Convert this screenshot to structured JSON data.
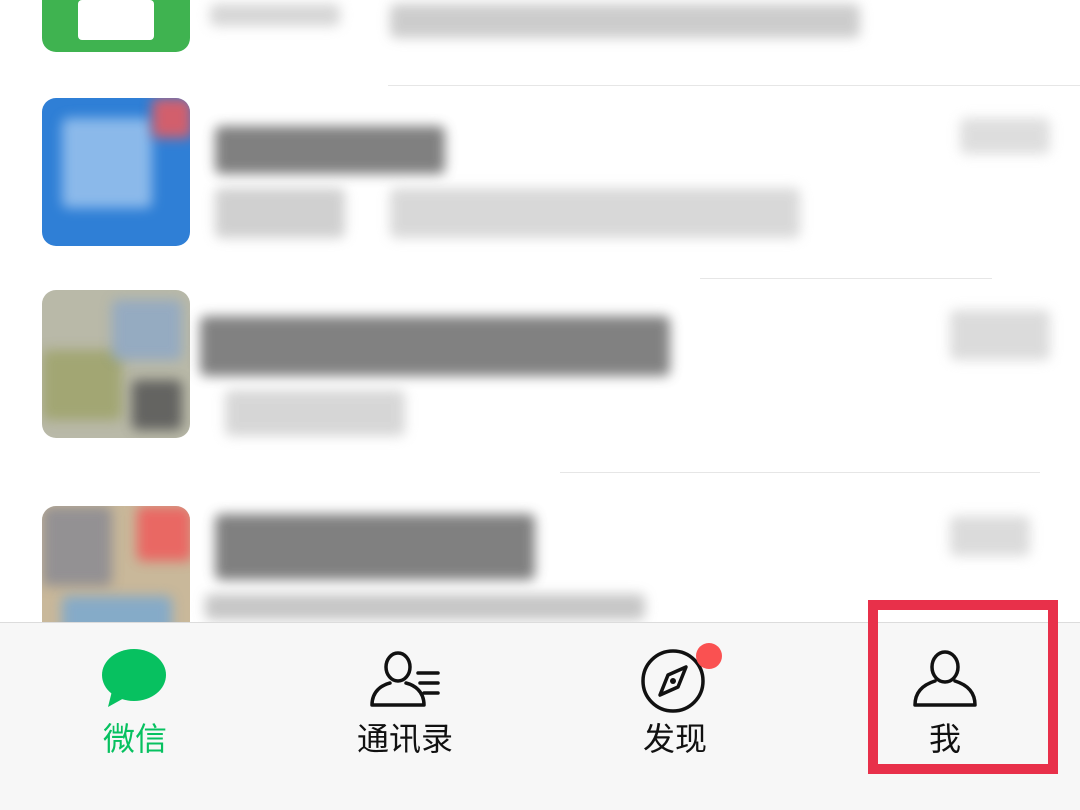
{
  "tabbar": {
    "tabs": [
      {
        "label": "微信",
        "icon": "chat-bubble-icon",
        "active": true
      },
      {
        "label": "通讯录",
        "icon": "contacts-icon",
        "active": false
      },
      {
        "label": "发现",
        "icon": "compass-icon",
        "active": false,
        "badge": "red-dot"
      },
      {
        "label": "我",
        "icon": "person-icon",
        "active": false
      }
    ]
  },
  "colors": {
    "active": "#07c160",
    "badge": "#fa5151",
    "highlight": "#e8304a"
  }
}
